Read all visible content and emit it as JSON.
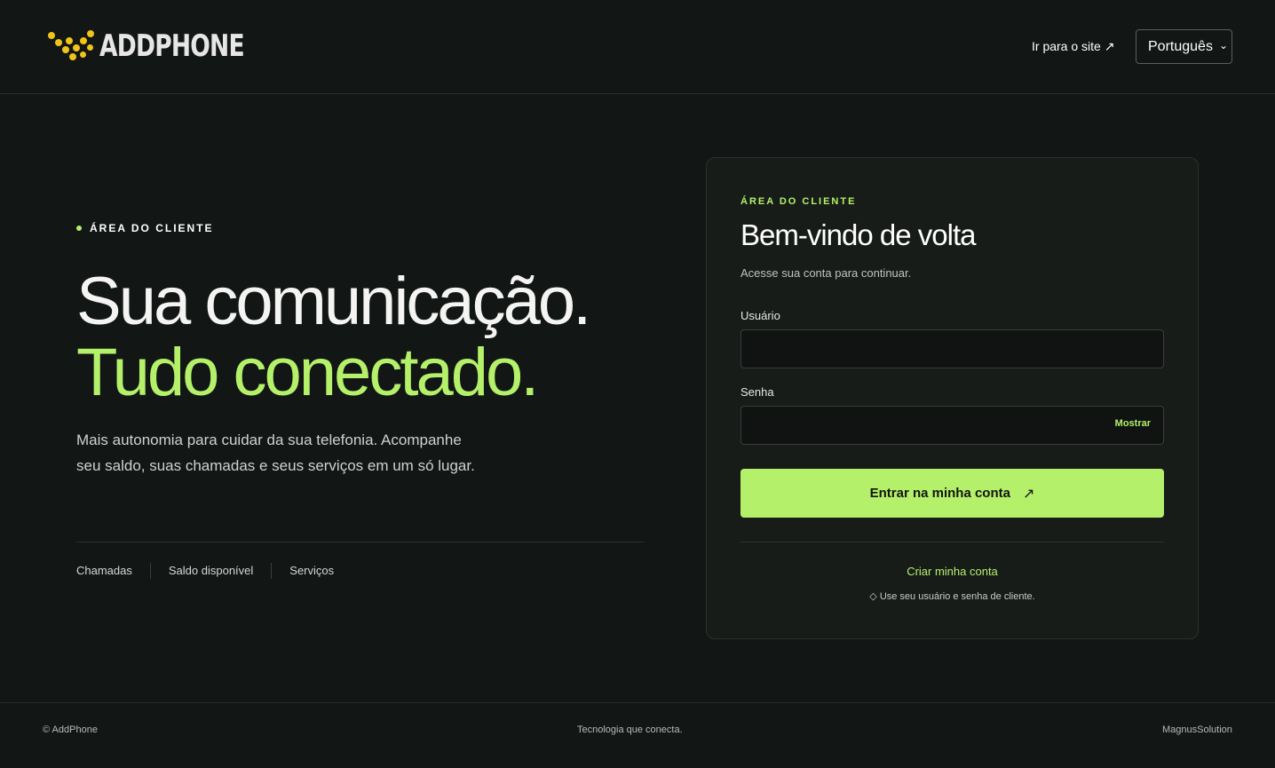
{
  "header": {
    "brand": "ADDPHONE",
    "site_link": "Ir para o site",
    "site_link_icon": "arrow-up-right-icon",
    "language": "Português",
    "language_icon": "chevron-down-icon"
  },
  "hero": {
    "eyebrow": "ÁREA DO CLIENTE",
    "headline_line1": "Sua comunicação.",
    "headline_line2": "Tudo conectado.",
    "lead": "Mais autonomia para cuidar da sua telefonia. Acompanhe seu saldo, suas chamadas e seus serviços em um só lugar.",
    "features": [
      "Chamadas",
      "Saldo disponível",
      "Serviços"
    ]
  },
  "login": {
    "eyebrow": "ÁREA DO CLIENTE",
    "title": "Bem-vindo de volta",
    "subtitle": "Acesse sua conta para continuar.",
    "username_label": "Usuário",
    "username_value": "",
    "password_label": "Senha",
    "password_value": "",
    "show_label": "Mostrar",
    "submit_label": "Entrar na minha conta",
    "create_account": "Criar minha conta",
    "hint": "◇ Use seu usuário e senha de cliente."
  },
  "footer": {
    "copyright": "© AddPhone",
    "tagline": "Tecnologia que conecta.",
    "credit": "MagnusSolution"
  },
  "colors": {
    "background": "#121614",
    "accent": "#b4f06a",
    "logo_dots": "#f0c419",
    "card": "#181c19"
  }
}
